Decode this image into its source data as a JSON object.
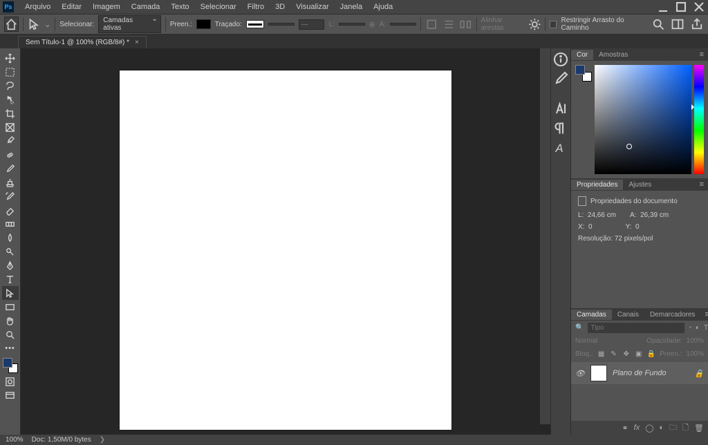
{
  "app": {
    "ps_label": "Ps"
  },
  "menu": [
    "Arquivo",
    "Editar",
    "Imagem",
    "Camada",
    "Texto",
    "Selecionar",
    "Filtro",
    "3D",
    "Visualizar",
    "Janela",
    "Ajuda"
  ],
  "options": {
    "selecionar_label": "Selecionar:",
    "selecionar_value": "Camadas ativas",
    "preen_label": "Preen.:",
    "tracado_label": "Traçado:",
    "largura_placeholder": "—",
    "altura_placeholder": "—",
    "l_label": "L:",
    "a_label": "A:",
    "alinhar_label": "Alinhar arestas",
    "restringir_label": "Restringir Arrasto do Caminho"
  },
  "tab": {
    "title": "Sem Título-1 @ 100% (RGB/8#) *"
  },
  "color_panel": {
    "tab_cor": "Cor",
    "tab_amostras": "Amostras"
  },
  "props_panel": {
    "tab_props": "Propriedades",
    "tab_ajustes": "Ajustes",
    "header": "Propriedades do documento",
    "l_label": "L:",
    "l_value": "24,66 cm",
    "a_label": "A:",
    "a_value": "26,39 cm",
    "x_label": "X:",
    "x_value": "0",
    "y_label": "Y:",
    "y_value": "0",
    "res_label": "Resolução:",
    "res_value": "72 pixels/pol"
  },
  "layers_panel": {
    "tab_camadas": "Camadas",
    "tab_canais": "Canais",
    "tab_demarcadores": "Demarcadores",
    "search_placeholder": "Tipo",
    "blend_mode": "Normal",
    "opacidade_label": "Opacidade:",
    "opacidade_value": "100%",
    "bloq_label": "Bloq.:",
    "preen_label": "Preen.:",
    "preen_value": "100%",
    "layer0_name": "Plano de Fundo"
  },
  "status": {
    "zoom": "100%",
    "doc": "Doc: 1,50M/0 bytes"
  }
}
